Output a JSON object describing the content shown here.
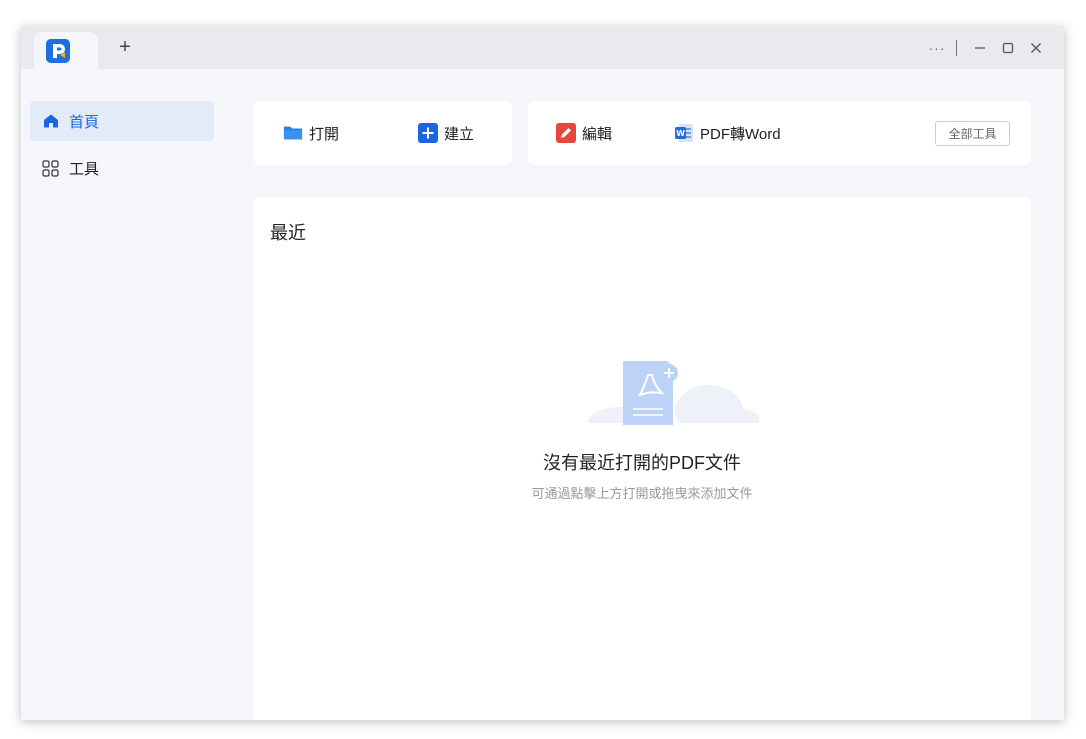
{
  "titlebar": {
    "new_tab_label": "+",
    "more_label": "···"
  },
  "sidebar": {
    "items": [
      {
        "label": "首頁",
        "icon": "home-icon",
        "active": true
      },
      {
        "label": "工具",
        "icon": "grid-icon",
        "active": false
      }
    ]
  },
  "toolbar": {
    "left_group": [
      {
        "label": "打開",
        "icon": "folder-icon"
      },
      {
        "label": "建立",
        "icon": "plus-square-icon"
      }
    ],
    "right_group": [
      {
        "label": "編輯",
        "icon": "edit-icon"
      },
      {
        "label": "PDF轉Word",
        "icon": "word-icon"
      }
    ],
    "all_tools_label": "全部工具"
  },
  "recent": {
    "title": "最近",
    "empty_title": "沒有最近打開的PDF文件",
    "empty_subtitle": "可通過點擊上方打開或拖曳來添加文件"
  },
  "colors": {
    "accent": "#1a66e0",
    "edit_red": "#e8453c",
    "word_blue": "#2b6bd6"
  }
}
